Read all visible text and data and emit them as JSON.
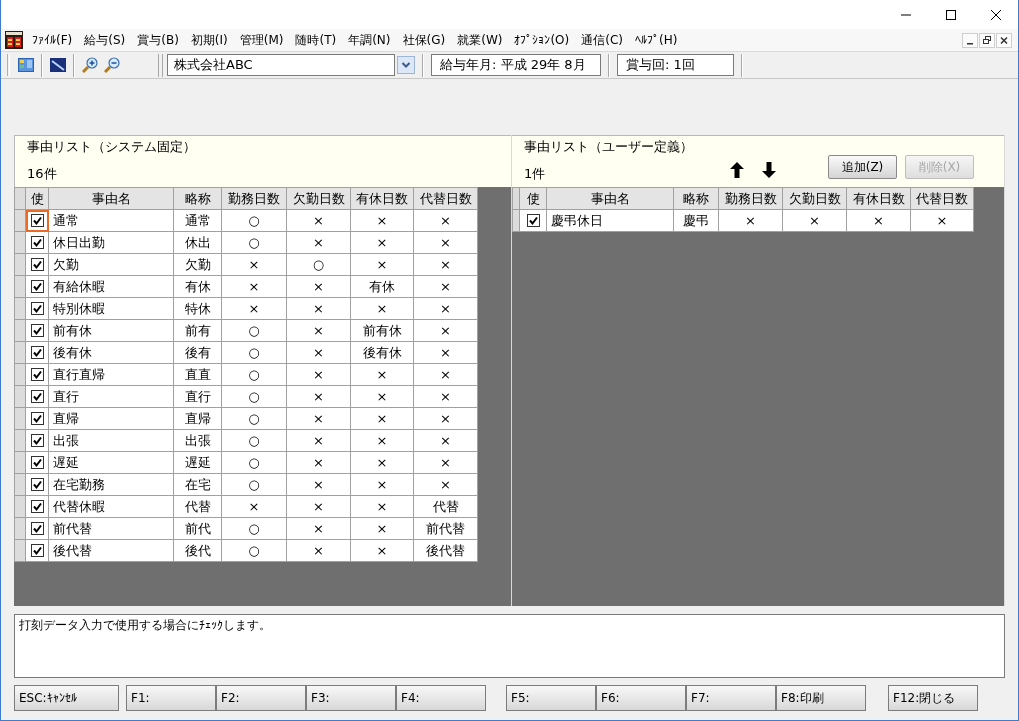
{
  "menu_bar": {
    "items": [
      "ﾌｧｲﾙ(F)",
      "給与(S)",
      "賞与(B)",
      "初期(I)",
      "管理(M)",
      "随時(T)",
      "年調(N)",
      "社保(G)",
      "就業(W)",
      "ｵﾌﾟｼｮﾝ(O)",
      "通信(C)",
      "ﾍﾙﾌﾟ(H)"
    ]
  },
  "toolbar": {
    "company": "株式会社ABC",
    "pay_month": "給与年月: 平成 29年 8月",
    "bonus_round": "賞与回: 1回"
  },
  "system_list": {
    "title": "事由リスト（システム固定）",
    "count": "16件",
    "check_column": "使",
    "columns": [
      "事由名",
      "略称",
      "勤務日数",
      "欠勤日数",
      "有休日数",
      "代替日数"
    ],
    "rows": [
      {
        "checked": true,
        "selected": true,
        "cells": [
          "通常",
          "通常",
          "○",
          "×",
          "×",
          "×"
        ]
      },
      {
        "checked": true,
        "selected": false,
        "cells": [
          "休日出勤",
          "休出",
          "○",
          "×",
          "×",
          "×"
        ]
      },
      {
        "checked": true,
        "selected": false,
        "cells": [
          "欠勤",
          "欠勤",
          "×",
          "○",
          "×",
          "×"
        ]
      },
      {
        "checked": true,
        "selected": false,
        "cells": [
          "有給休暇",
          "有休",
          "×",
          "×",
          "有休",
          "×"
        ]
      },
      {
        "checked": true,
        "selected": false,
        "cells": [
          "特別休暇",
          "特休",
          "×",
          "×",
          "×",
          "×"
        ]
      },
      {
        "checked": true,
        "selected": false,
        "cells": [
          "前有休",
          "前有",
          "○",
          "×",
          "前有休",
          "×"
        ]
      },
      {
        "checked": true,
        "selected": false,
        "cells": [
          "後有休",
          "後有",
          "○",
          "×",
          "後有休",
          "×"
        ]
      },
      {
        "checked": true,
        "selected": false,
        "cells": [
          "直行直帰",
          "直直",
          "○",
          "×",
          "×",
          "×"
        ]
      },
      {
        "checked": true,
        "selected": false,
        "cells": [
          "直行",
          "直行",
          "○",
          "×",
          "×",
          "×"
        ]
      },
      {
        "checked": true,
        "selected": false,
        "cells": [
          "直帰",
          "直帰",
          "○",
          "×",
          "×",
          "×"
        ]
      },
      {
        "checked": true,
        "selected": false,
        "cells": [
          "出張",
          "出張",
          "○",
          "×",
          "×",
          "×"
        ]
      },
      {
        "checked": true,
        "selected": false,
        "cells": [
          "遅延",
          "遅延",
          "○",
          "×",
          "×",
          "×"
        ]
      },
      {
        "checked": true,
        "selected": false,
        "cells": [
          "在宅勤務",
          "在宅",
          "○",
          "×",
          "×",
          "×"
        ]
      },
      {
        "checked": true,
        "selected": false,
        "cells": [
          "代替休暇",
          "代替",
          "×",
          "×",
          "×",
          "代替"
        ]
      },
      {
        "checked": true,
        "selected": false,
        "cells": [
          "前代替",
          "前代",
          "○",
          "×",
          "×",
          "前代替"
        ]
      },
      {
        "checked": true,
        "selected": false,
        "cells": [
          "後代替",
          "後代",
          "○",
          "×",
          "×",
          "後代替"
        ]
      }
    ]
  },
  "user_list": {
    "title": "事由リスト（ユーザー定義）",
    "count": "1件",
    "buttons": [
      {
        "label": "追加(Z)",
        "disabled": false
      },
      {
        "label": "削除(X)",
        "disabled": true
      }
    ],
    "check_column": "使",
    "columns": [
      "事由名",
      "略称",
      "勤務日数",
      "欠勤日数",
      "有休日数",
      "代替日数"
    ],
    "rows": [
      {
        "checked": true,
        "selected": false,
        "cells": [
          "慶弔休日",
          "慶弔",
          "×",
          "×",
          "×",
          "×"
        ]
      }
    ]
  },
  "message": "打刻データ入力で使用する場合にﾁｪｯｸします。",
  "function_keys": [
    [
      "ESC:ｷｬﾝｾﾙ"
    ],
    [
      "F1:",
      "F2:",
      "F3:",
      "F4:"
    ],
    [
      "F5:",
      "F6:",
      "F7:",
      "F8:印刷"
    ],
    [
      "F12:閉じる"
    ]
  ]
}
